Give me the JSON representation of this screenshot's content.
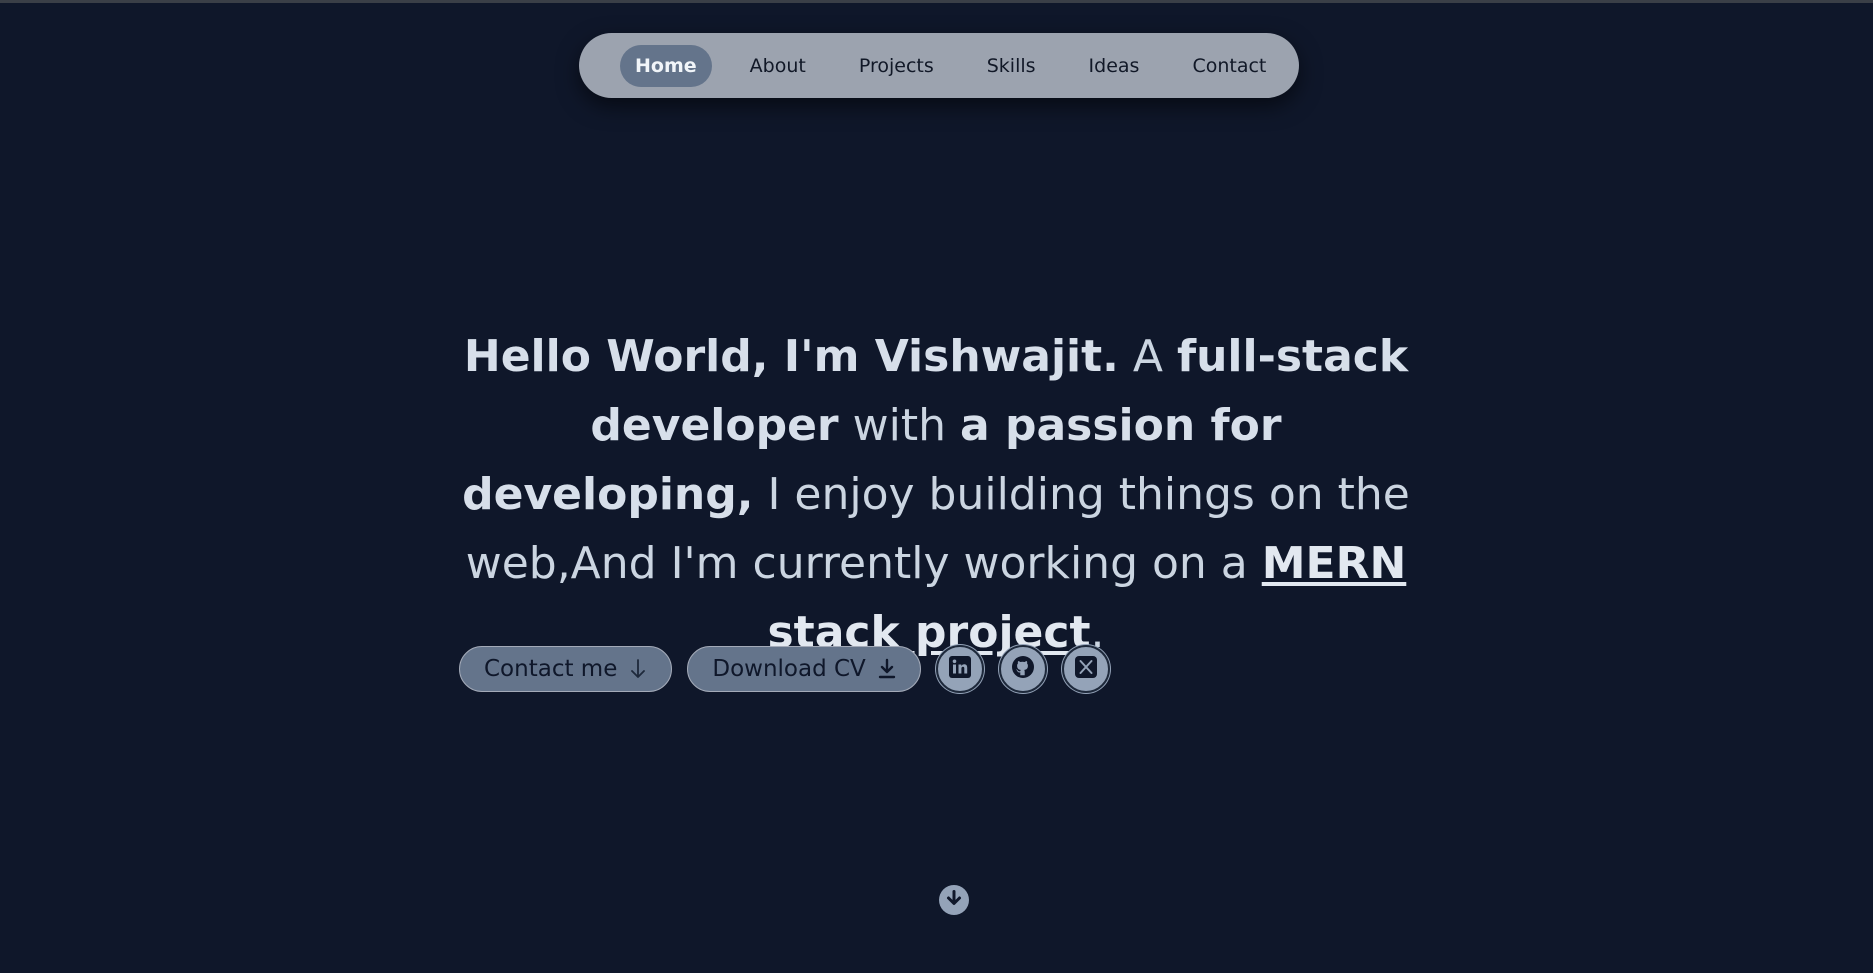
{
  "nav": {
    "items": [
      {
        "label": "Home",
        "active": true
      },
      {
        "label": "About"
      },
      {
        "label": "Projects"
      },
      {
        "label": "Skills"
      },
      {
        "label": "Ideas"
      },
      {
        "label": "Contact"
      }
    ]
  },
  "hero": {
    "greeting": "Hello World, I'm Vishwajit.",
    "text_a": " A ",
    "role": "full-stack developer",
    "text_with": " with ",
    "passion": "a passion for developing,",
    "text_b": " I enjoy building things on the web,And I'm currently working on a ",
    "project_link": "MERN stack project",
    "period": "."
  },
  "actions": {
    "contact_label": "Contact me",
    "download_label": "Download CV"
  },
  "social": {
    "icons": [
      "linkedin-icon",
      "github-icon",
      "x-icon"
    ]
  },
  "colors": {
    "background": "#0f172a",
    "nav_bg": "#9ca3af",
    "accent": "#64748b",
    "text": "#cbd5e1"
  }
}
